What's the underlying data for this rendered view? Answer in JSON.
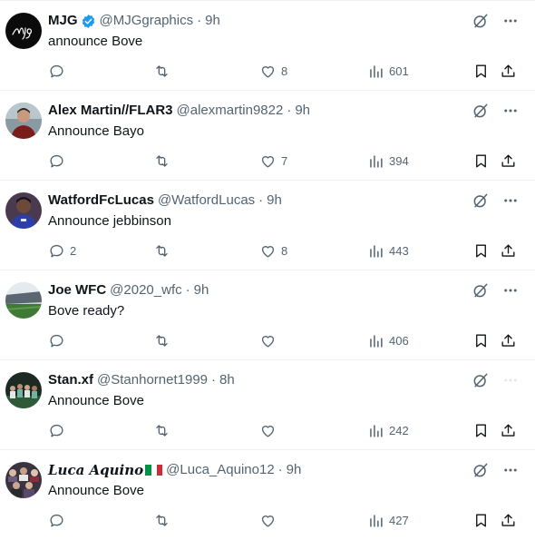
{
  "tweets": [
    {
      "name": "MJG",
      "verified": true,
      "handle": "@MJGgraphics",
      "time": "9h",
      "text": "announce Bove",
      "replies": "",
      "retweets": "",
      "likes": "8",
      "views": "601",
      "avatar": "avatar-mjg-logo"
    },
    {
      "name": "Alex Martin//FLAR3",
      "verified": false,
      "handle": "@alexmartin9822",
      "time": "9h",
      "text": "Announce Bayo",
      "replies": "",
      "retweets": "",
      "likes": "7",
      "views": "394",
      "avatar": "avatar-person-red-shirt"
    },
    {
      "name": "WatfordFcLucas",
      "verified": false,
      "handle": "@WatfordLucas",
      "time": "9h",
      "text": "Announce jebbinson",
      "replies": "2",
      "retweets": "",
      "likes": "8",
      "views": "443",
      "avatar": "avatar-person-blue-shirt"
    },
    {
      "name": "Joe WFC",
      "verified": false,
      "handle": "@2020_wfc",
      "time": "9h",
      "text": "Bove ready?",
      "replies": "",
      "retweets": "",
      "likes": "",
      "views": "406",
      "avatar": "avatar-stadium"
    },
    {
      "name": "Stan.xf",
      "verified": false,
      "handle": "@Stanhornet1999",
      "time": "8h",
      "text": "Announce Bove",
      "replies": "",
      "retweets": "",
      "likes": "",
      "views": "242",
      "avatar": "avatar-team-photo"
    },
    {
      "name": "Luca Aquino",
      "verified": false,
      "flag": "italy-flag",
      "handle": "@Luca_Aquino12",
      "time": "9h",
      "text": "Announce Bove",
      "replies": "",
      "retweets": "",
      "likes": "",
      "views": "427",
      "avatar": "avatar-crowd"
    }
  ],
  "separator": "·",
  "colors": {
    "text": "#0f1419",
    "muted": "#536471",
    "verified": "#1d9bf0",
    "border": "#eff3f4"
  },
  "icons": [
    "reply-icon",
    "retweet-icon",
    "like-icon",
    "views-icon",
    "bookmark-icon",
    "share-icon",
    "grok-icon",
    "more-icon",
    "verified-badge-icon"
  ]
}
